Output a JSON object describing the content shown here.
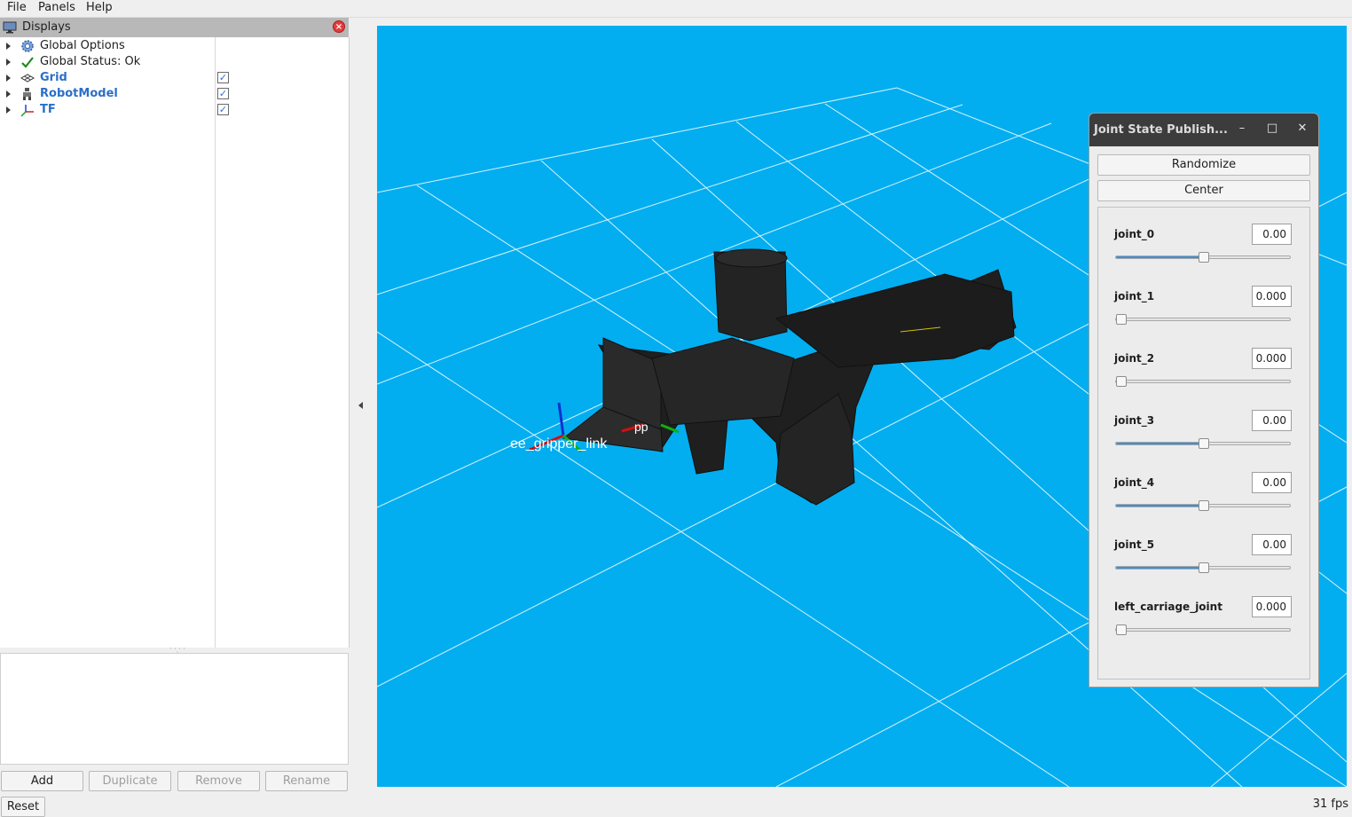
{
  "menubar": {
    "items": [
      "File",
      "Panels",
      "Help"
    ]
  },
  "displays": {
    "title": "Displays",
    "items": [
      {
        "label": "Global Options",
        "icon": "gear-icon"
      },
      {
        "label": "Global Status: Ok",
        "icon": "check-icon"
      },
      {
        "label": "Grid",
        "icon": "grid-icon",
        "checked": true
      },
      {
        "label": "RobotModel",
        "icon": "robot-icon",
        "checked": true
      },
      {
        "label": "TF",
        "icon": "axes-icon",
        "checked": true
      }
    ],
    "buttons": {
      "add": "Add",
      "duplicate": "Duplicate",
      "remove": "Remove",
      "rename": "Rename"
    }
  },
  "footer": {
    "reset": "Reset",
    "fps": "31 fps"
  },
  "viewport": {
    "background": "#02aef0",
    "frame_labels": {
      "ee": "ee_gripper_link",
      "pp": "pp"
    }
  },
  "joint_window": {
    "title": "Joint State Publish...",
    "randomize": "Randomize",
    "center": "Center",
    "joints": [
      {
        "name": "joint_0",
        "value": "0.00",
        "level": 0.5
      },
      {
        "name": "joint_1",
        "value": "0.000",
        "level": 0.0
      },
      {
        "name": "joint_2",
        "value": "0.000",
        "level": 0.0
      },
      {
        "name": "joint_3",
        "value": "0.00",
        "level": 0.5
      },
      {
        "name": "joint_4",
        "value": "0.00",
        "level": 0.5
      },
      {
        "name": "joint_5",
        "value": "0.00",
        "level": 0.5
      },
      {
        "name": "left_carriage_joint",
        "value": "0.000",
        "level": 0.0
      }
    ]
  }
}
